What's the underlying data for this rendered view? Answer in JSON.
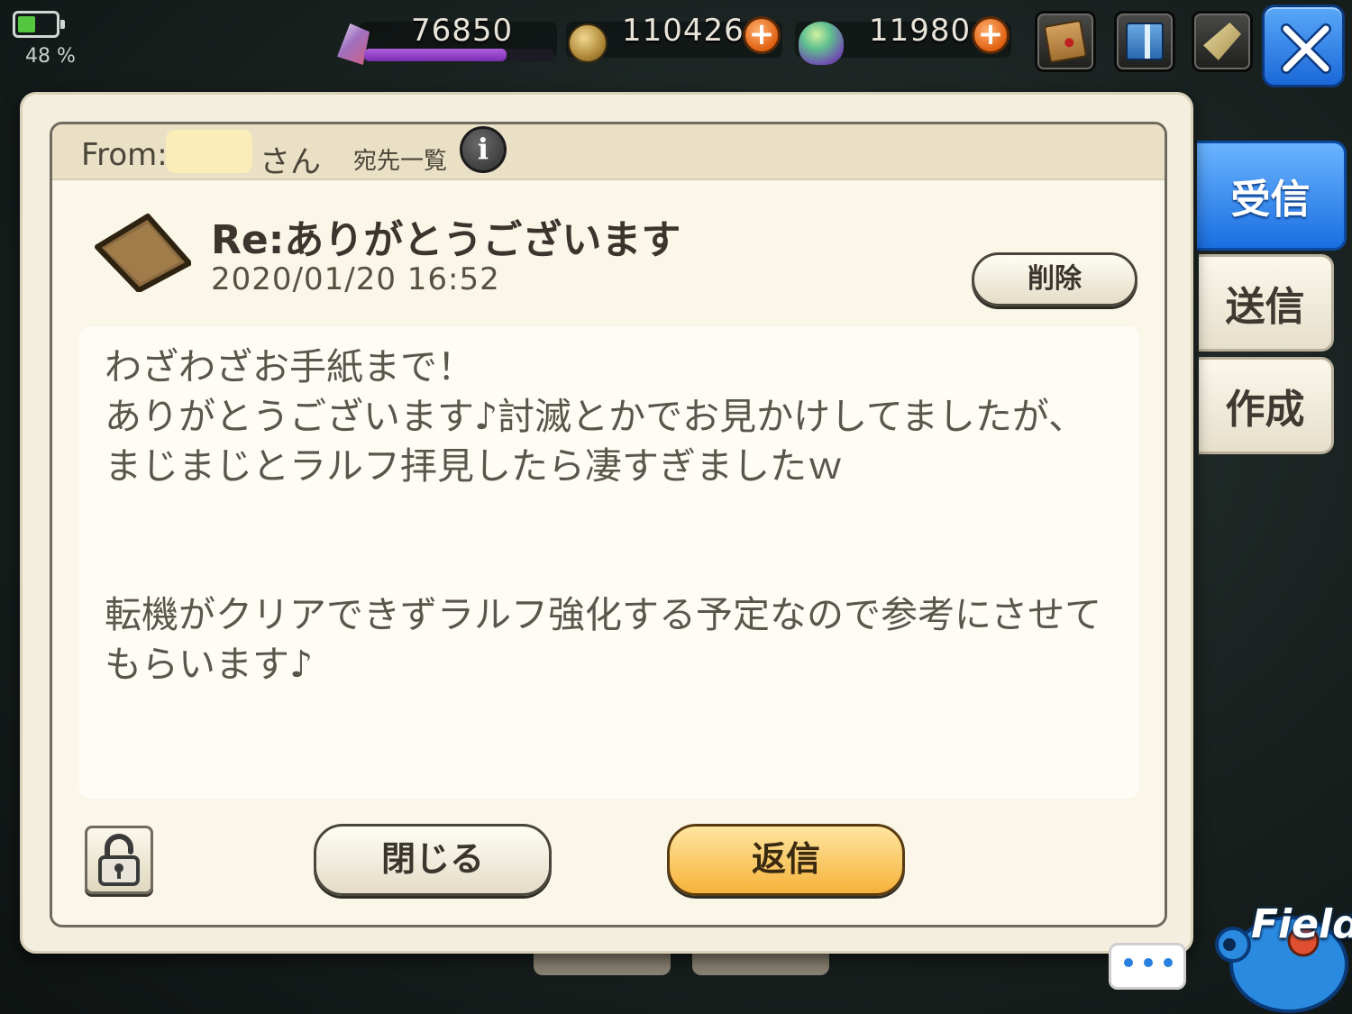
{
  "status": {
    "battery_percent": "48 %",
    "battery_level": 0.48
  },
  "resources": {
    "crystal": {
      "value": "76850",
      "bar_fill": 0.75,
      "icon": "crystal-icon"
    },
    "coin": {
      "value": "110426",
      "icon": "coin-icon",
      "add_icon": "plus-icon"
    },
    "gem": {
      "value": "11980",
      "icon": "gem-icon",
      "add_icon": "plus-icon"
    }
  },
  "top_buttons": [
    "mail-icon",
    "gift-icon",
    "horn-icon",
    "close-icon"
  ],
  "side_tabs": [
    {
      "label": "受信",
      "active": true
    },
    {
      "label": "送信",
      "active": false
    },
    {
      "label": "作成",
      "active": false
    }
  ],
  "message": {
    "from_label": "From:",
    "from_suffix": "さん",
    "recipients_link": "宛先一覧",
    "info_label": "i",
    "subject": "Re:ありがとうございます",
    "date": "2020/01/20 16:52",
    "delete_label": "削除",
    "body": "わざわざお手紙まで！\nありがとうございます♪討滅とかでお見かけしてましたが、\nまじまじとラルフ拝見したら凄すぎましたｗ\n\n\n転機がクリアできずラルフ強化する予定なので参考にさせて\nもらいます♪"
  },
  "footer": {
    "close_label": "閉じる",
    "reply_label": "返信",
    "lock_icon": "lock-icon"
  },
  "field_button": {
    "label": "Field"
  },
  "colors": {
    "accent_blue": "#1a6ee0",
    "reply_orange": "#f6b23a",
    "panel": "#faf6e8"
  }
}
